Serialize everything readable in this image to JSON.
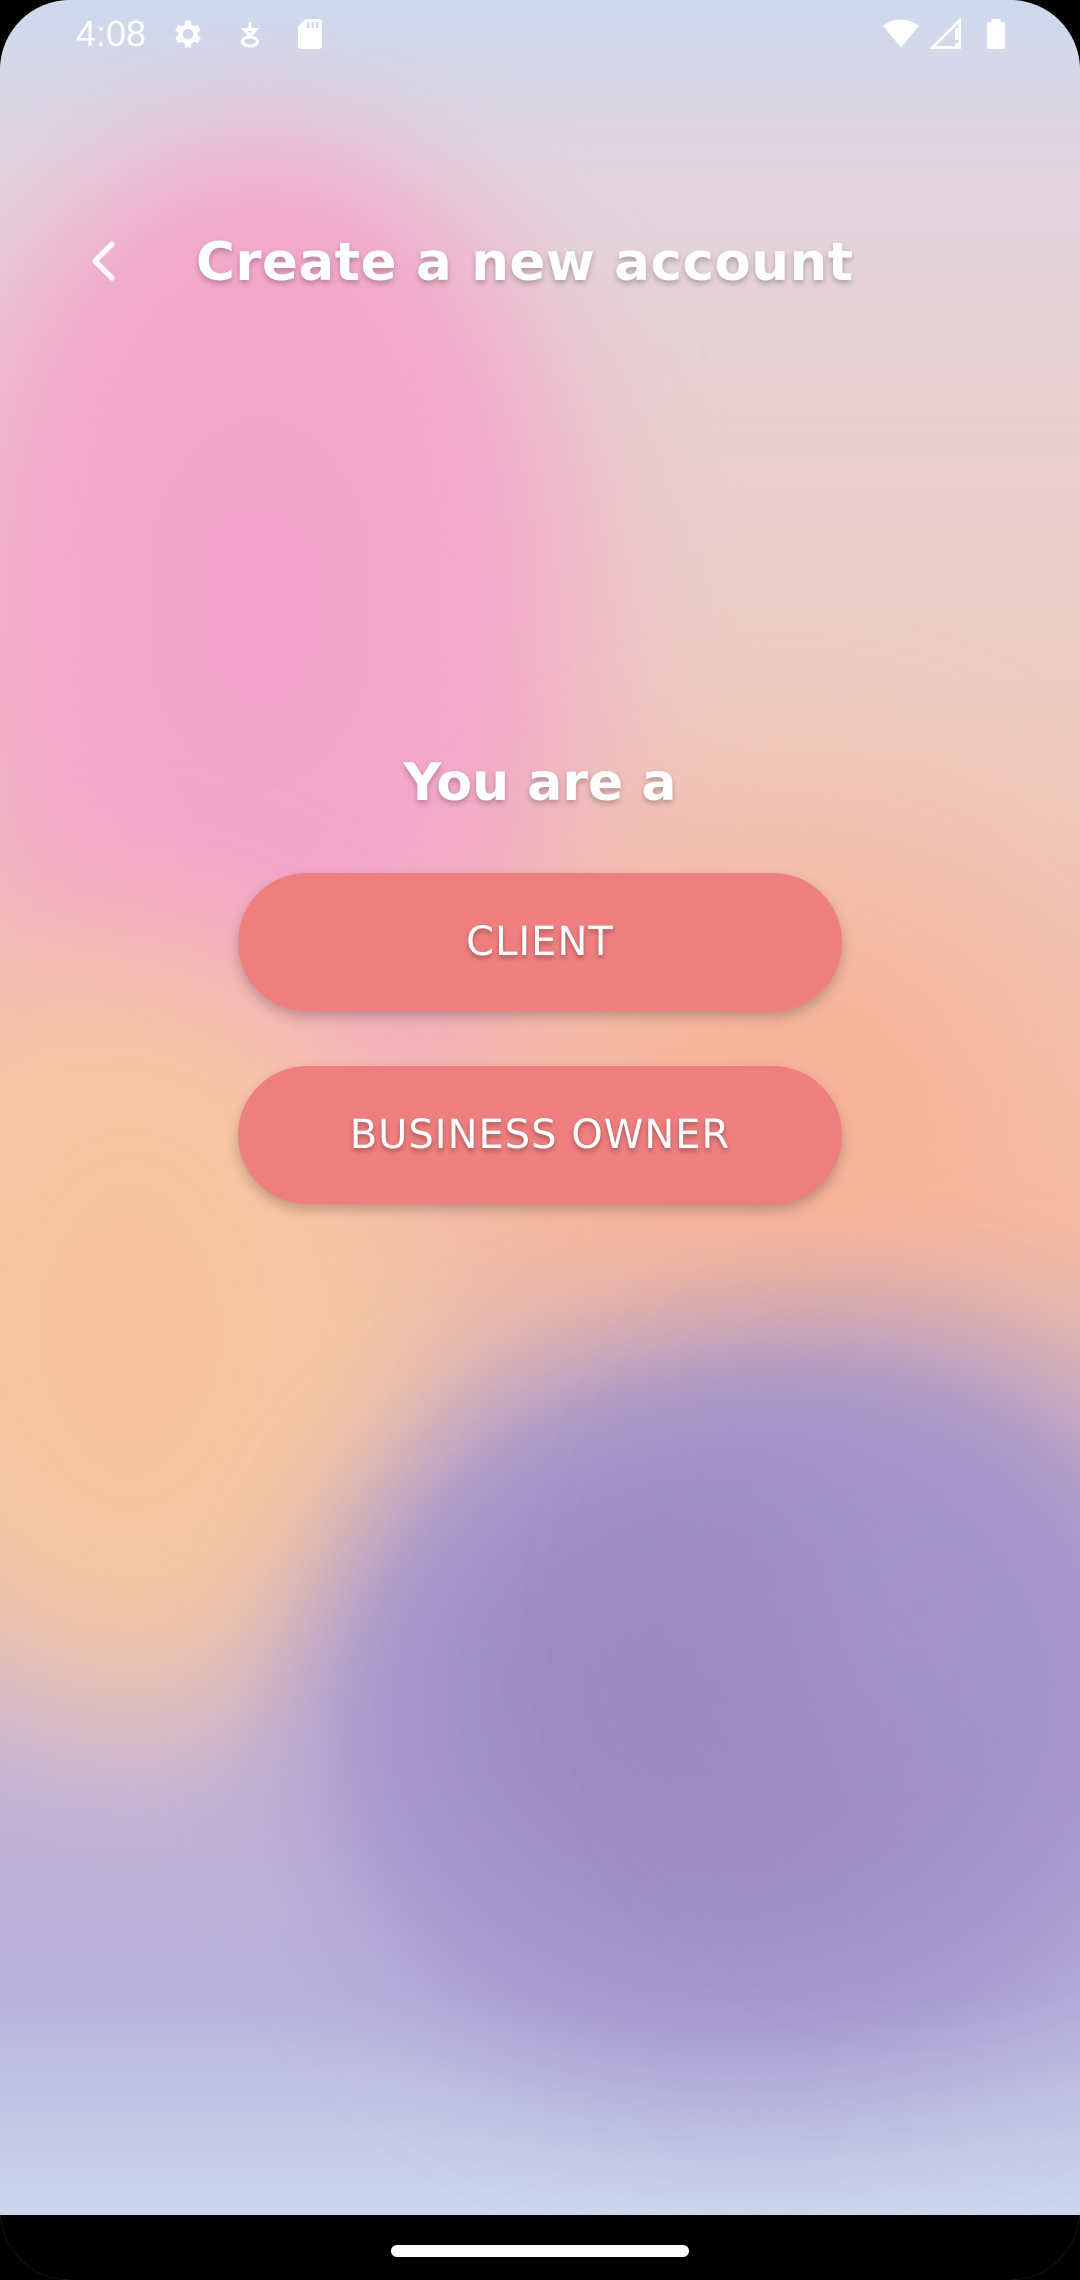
{
  "status_bar": {
    "time": "4:08",
    "icons": [
      "gear-icon",
      "notification-icon",
      "sd-card-icon",
      "wifi-icon",
      "signal-icon",
      "battery-icon"
    ]
  },
  "header": {
    "title": "Create a new account",
    "back_icon": "chevron-left-icon"
  },
  "main": {
    "prompt": "You are a",
    "client_label": "CLIENT",
    "business_owner_label": "BUSINESS OWNER"
  },
  "colors": {
    "button": "#ef7e7e",
    "text": "#ffffff",
    "pink": "#f3a2cd",
    "orange": "#f8c29a",
    "purple": "#9783be"
  }
}
